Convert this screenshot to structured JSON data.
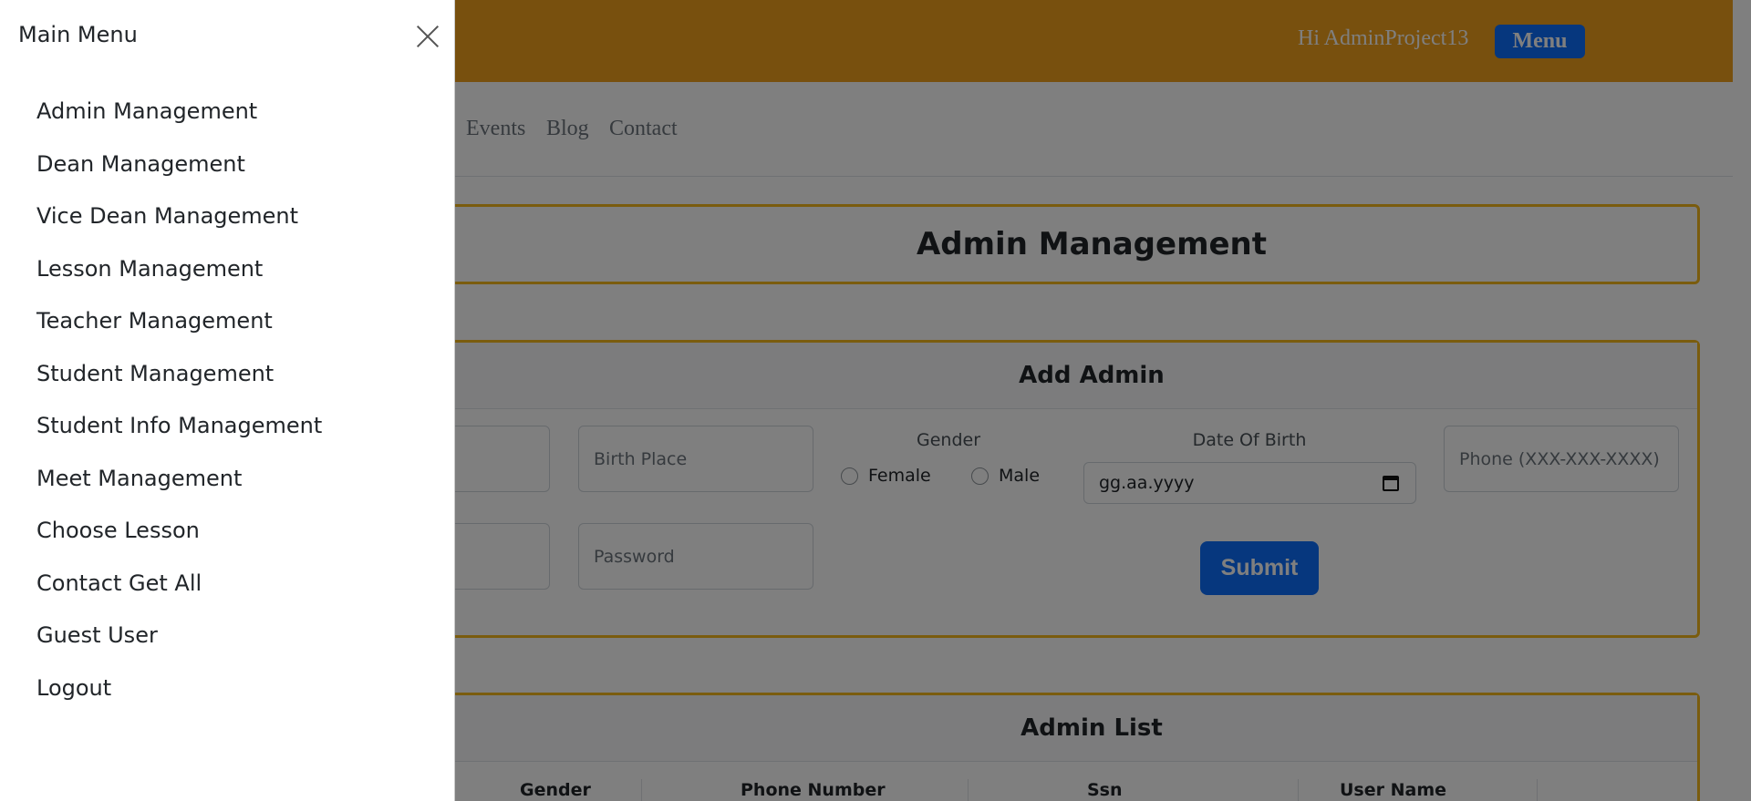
{
  "topbar": {
    "greeting": "Hi AdminProject13",
    "menu_label": "Menu"
  },
  "nav": {
    "links": [
      "Events",
      "Blog",
      "Contact"
    ]
  },
  "page_header": {
    "title": "Admin Management"
  },
  "add_admin": {
    "title": "Add Admin",
    "birth_place_placeholder": "Birth Place",
    "gender_label": "Gender",
    "gender_options": [
      "Female",
      "Male"
    ],
    "dob_label": "Date Of Birth",
    "dob_value": "gg.aa.yyyy",
    "phone_placeholder": "Phone (XXX-XXX-XXXX)",
    "password_placeholder": "Password",
    "submit_label": "Submit"
  },
  "admin_list": {
    "title": "Admin List",
    "columns": [
      "Gender",
      "Phone Number",
      "Ssn",
      "User Name"
    ]
  },
  "offcanvas": {
    "title": "Main Menu",
    "items": [
      "Admin Management",
      "Dean Management",
      "Vice Dean Management",
      "Lesson Management",
      "Teacher Management",
      "Student Management",
      "Student Info Management",
      "Meet Management",
      "Choose Lesson",
      "Contact Get All",
      "Guest User",
      "Logout"
    ]
  },
  "colors": {
    "topbar": "#f0a01c",
    "card_border": "#f5b81c",
    "primary": "#0d6efd",
    "backdrop": "rgba(0,0,0,0.5)"
  }
}
